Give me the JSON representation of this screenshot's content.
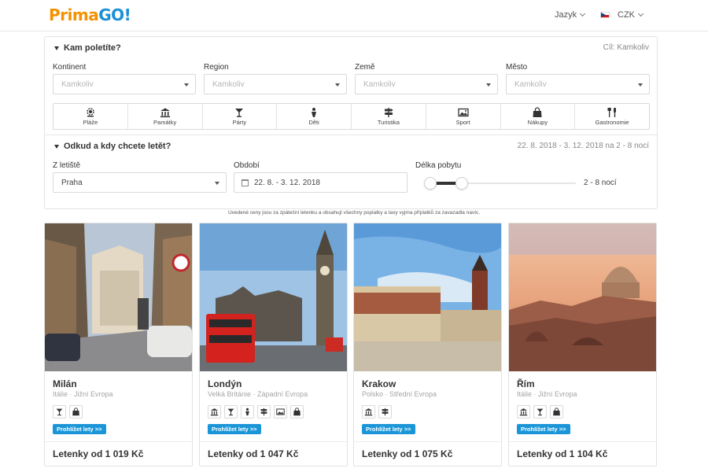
{
  "brand": {
    "prima": "Prima",
    "go": "GO!"
  },
  "header": {
    "language_label": "Jazyk",
    "currency_label": "CZK"
  },
  "destination": {
    "title": "Kam poletíte?",
    "summary": "Cíl: Kamkoliv",
    "fields": [
      {
        "label": "Kontinent",
        "placeholder": "Kamkoliv"
      },
      {
        "label": "Region",
        "placeholder": "Kamkoliv"
      },
      {
        "label": "Země",
        "placeholder": "Kamkoliv"
      },
      {
        "label": "Město",
        "placeholder": "Kamkoliv"
      }
    ],
    "categories": [
      {
        "label": "Pláže",
        "icon": "beach-icon"
      },
      {
        "label": "Památky",
        "icon": "monument-icon"
      },
      {
        "label": "Párty",
        "icon": "cocktail-icon"
      },
      {
        "label": "Děti",
        "icon": "child-icon"
      },
      {
        "label": "Turistika",
        "icon": "signpost-icon"
      },
      {
        "label": "Sport",
        "icon": "picture-icon"
      },
      {
        "label": "Nákupy",
        "icon": "shopping-bag-icon"
      },
      {
        "label": "Gastronomie",
        "icon": "cutlery-icon"
      }
    ]
  },
  "departure": {
    "title": "Odkud a kdy chcete letět?",
    "summary": "22. 8. 2018 - 3. 12. 2018 na 2 - 8 nocí",
    "airport": {
      "label": "Z letiště",
      "value": "Praha"
    },
    "period": {
      "label": "Období",
      "value": "22. 8. - 3. 12. 2018"
    },
    "stay": {
      "label": "Délka pobytu",
      "value": "2 - 8 nocí"
    }
  },
  "disclaimer": "Uvedené ceny jsou za zpáteční letenku a obsahují všechny poplatky a taxy vyjma příplatků za zavazadla navíc.",
  "cards": [
    {
      "city": "Milán",
      "region": "Itálie · Jižní Evropa",
      "icons": [
        "cocktail-icon",
        "shopping-bag-icon"
      ],
      "button": "Prohlížet lety >>",
      "price": "Letenky od 1 019 Kč"
    },
    {
      "city": "Londýn",
      "region": "Velká Británie · Západní Evropa",
      "icons": [
        "monument-icon",
        "cocktail-icon",
        "child-icon",
        "signpost-icon",
        "picture-icon",
        "shopping-bag-icon"
      ],
      "button": "Prohlížet lety >>",
      "price": "Letenky od 1 047 Kč"
    },
    {
      "city": "Krakow",
      "region": "Polsko · Střední Evropa",
      "icons": [
        "monument-icon",
        "signpost-icon"
      ],
      "button": "Prohlížet lety >>",
      "price": "Letenky od 1 075 Kč"
    },
    {
      "city": "Řím",
      "region": "Itálie · Jižní Evropa",
      "icons": [
        "monument-icon",
        "cocktail-icon",
        "shopping-bag-icon"
      ],
      "button": "Prohlížet lety >>",
      "price": "Letenky od 1 104 Kč"
    }
  ],
  "colors": {
    "brand_orange": "#f39200",
    "brand_blue": "#1a8fd6",
    "button_blue": "#1a96d8"
  }
}
